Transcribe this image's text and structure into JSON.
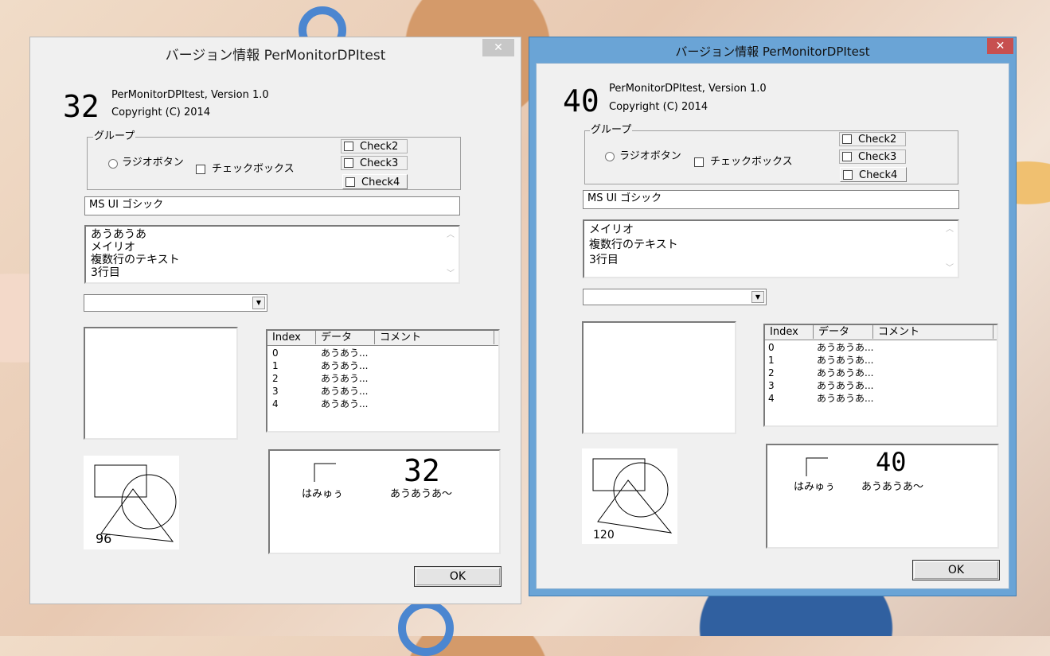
{
  "windows": [
    {
      "title": "バージョン情報 PerMonitorDPItest",
      "close_glyph": "✕",
      "dpi_large": "32",
      "app_name": "PerMonitorDPItest, Version 1.0",
      "copyright": "Copyright (C) 2014",
      "group_label": "グループ",
      "radio_label": "ラジオボタン",
      "checkbox_label": "チェックボックス",
      "check2": "Check2",
      "check3": "Check3",
      "check4": "Check4",
      "font_field": "MS UI ゴシック",
      "multiline_lines": [
        "あうあうあ",
        "メイリオ",
        "複数行のテキスト",
        "3行目"
      ],
      "combo_value": "",
      "listview_headers": [
        "Index",
        "データ",
        "コメント"
      ],
      "listview_rows": [
        {
          "index": "0",
          "data": "あうあう..."
        },
        {
          "index": "1",
          "data": "あうあう..."
        },
        {
          "index": "2",
          "data": "あうあう..."
        },
        {
          "index": "3",
          "data": "あうあう..."
        },
        {
          "index": "4",
          "data": "あうあう..."
        }
      ],
      "shape_dpi": "96",
      "paint_label_left": "はみゅぅ",
      "paint_dpi": "32",
      "paint_label_right": "あうあうあ～",
      "ok_label": "OK"
    },
    {
      "title": "バージョン情報 PerMonitorDPItest",
      "close_glyph": "✕",
      "dpi_large": "40",
      "app_name": "PerMonitorDPItest, Version 1.0",
      "copyright": "Copyright (C) 2014",
      "group_label": "グループ",
      "radio_label": "ラジオボタン",
      "checkbox_label": "チェックボックス",
      "check2": "Check2",
      "check3": "Check3",
      "check4": "Check4",
      "font_field": "MS UI ゴシック",
      "multiline_lines": [
        "メイリオ",
        "複数行のテキスト",
        "3行目"
      ],
      "combo_value": "",
      "listview_headers": [
        "Index",
        "データ",
        "コメント"
      ],
      "listview_rows": [
        {
          "index": "0",
          "data": "あうあうあ..."
        },
        {
          "index": "1",
          "data": "あうあうあ..."
        },
        {
          "index": "2",
          "data": "あうあうあ..."
        },
        {
          "index": "3",
          "data": "あうあうあ..."
        },
        {
          "index": "4",
          "data": "あうあうあ..."
        }
      ],
      "shape_dpi": "120",
      "paint_label_left": "はみゅぅ",
      "paint_dpi": "40",
      "paint_label_right": "あうあうあ～",
      "ok_label": "OK"
    }
  ]
}
